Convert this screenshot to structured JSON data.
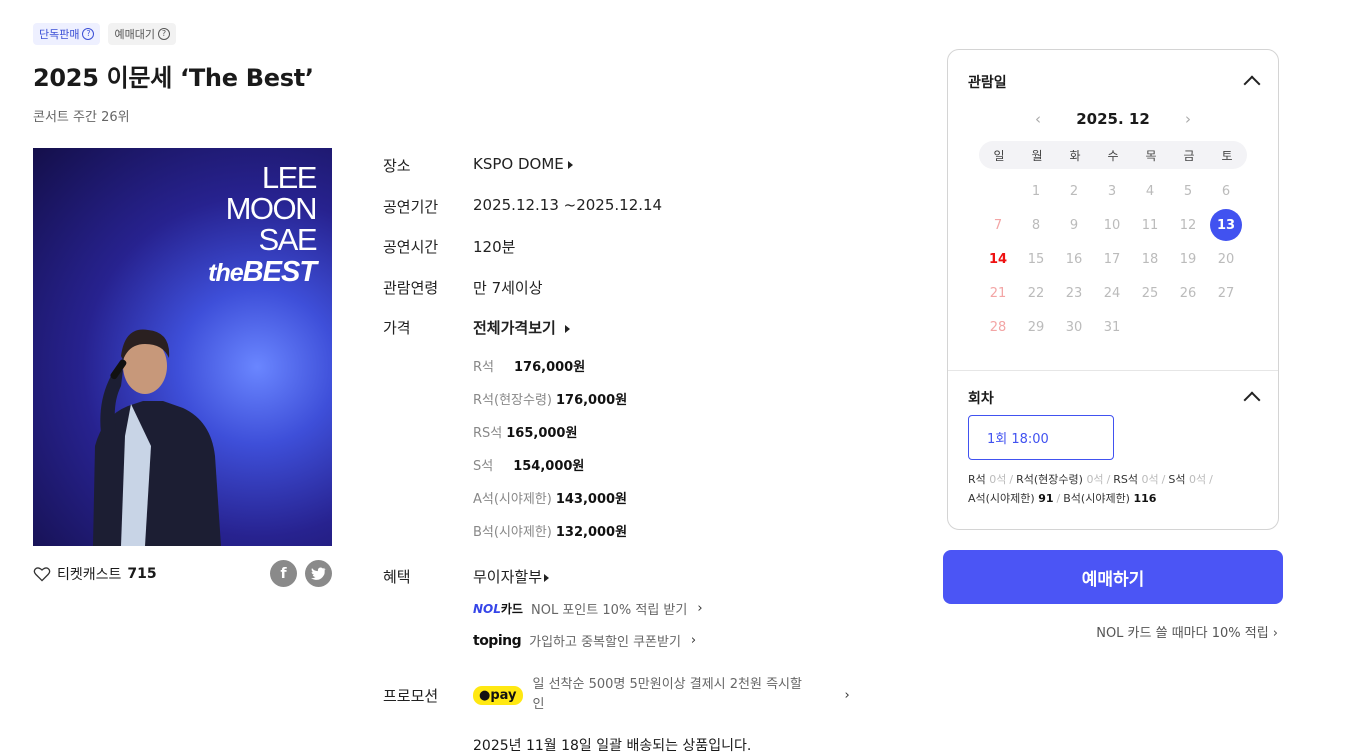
{
  "badges": {
    "exclusive": "단독판매",
    "waiting": "예매대기"
  },
  "title": "2025 이문세 ‘The Best’",
  "rank": "콘서트 주간 26위",
  "poster": {
    "line1": "LEE",
    "line2": "MOON",
    "line3": "SAE",
    "the": "the",
    "best": "BEST"
  },
  "likes": {
    "label": "티켓캐스트",
    "count": "715"
  },
  "share": {
    "facebook": "f",
    "twitter": "t"
  },
  "info": {
    "venue_label": "장소",
    "venue": "KSPO DOME",
    "period_label": "공연기간",
    "period": "2025.12.13 ~2025.12.14",
    "runtime_label": "공연시간",
    "runtime": "120분",
    "age_label": "관람연령",
    "age": "만 7세이상",
    "price_label": "가격",
    "price_all": "전체가격보기"
  },
  "prices": [
    {
      "grade": "R석",
      "price": "176,000원"
    },
    {
      "grade": "R석(현장수령)",
      "price": "176,000원"
    },
    {
      "grade": "RS석",
      "price": "165,000원"
    },
    {
      "grade": "S석",
      "price": "154,000원"
    },
    {
      "grade": "A석(시야제한)",
      "price": "143,000원"
    },
    {
      "grade": "B석(시야제한)",
      "price": "132,000원"
    }
  ],
  "benefits": {
    "label": "혜택",
    "main": "무이자할부",
    "nol_brand": "NOL",
    "nol_card": "카드",
    "nol_text": "NOL 포인트 10% 적립 받기",
    "toping_brand": "toping",
    "toping_text": "가입하고 중복할인 쿠폰받기"
  },
  "promotion": {
    "label": "프로모션",
    "kpay": "●pay",
    "line1": "일 선착순 500명 5만원이상 결제시 2천원 즉시할",
    "line2": "인"
  },
  "delivery": "2025년 11월 18일 일괄 배송되는 상품입니다.",
  "calendar": {
    "title": "관람일",
    "month": "2025. 12",
    "weekdays": [
      "일",
      "월",
      "화",
      "수",
      "목",
      "금",
      "토"
    ],
    "selected_day": "13"
  },
  "round": {
    "title": "회차",
    "button": "1회  18:00",
    "seats": [
      {
        "grade": "R석",
        "count": "0석"
      },
      {
        "grade": "R석(현장수령)",
        "count": "0석"
      },
      {
        "grade": "RS석",
        "count": "0석"
      },
      {
        "grade": "S석",
        "count": "0석"
      },
      {
        "grade": "A석(시야제한)",
        "count": "91"
      },
      {
        "grade": "B석(시야제한)",
        "count": "116"
      }
    ]
  },
  "book_button": "예매하기",
  "nol_promo": "NOL 카드 쓸 때마다 10% 적립",
  "colors": {
    "accent": "#4b55f5",
    "sunday": "#e11111",
    "kakao": "#ffe812"
  }
}
